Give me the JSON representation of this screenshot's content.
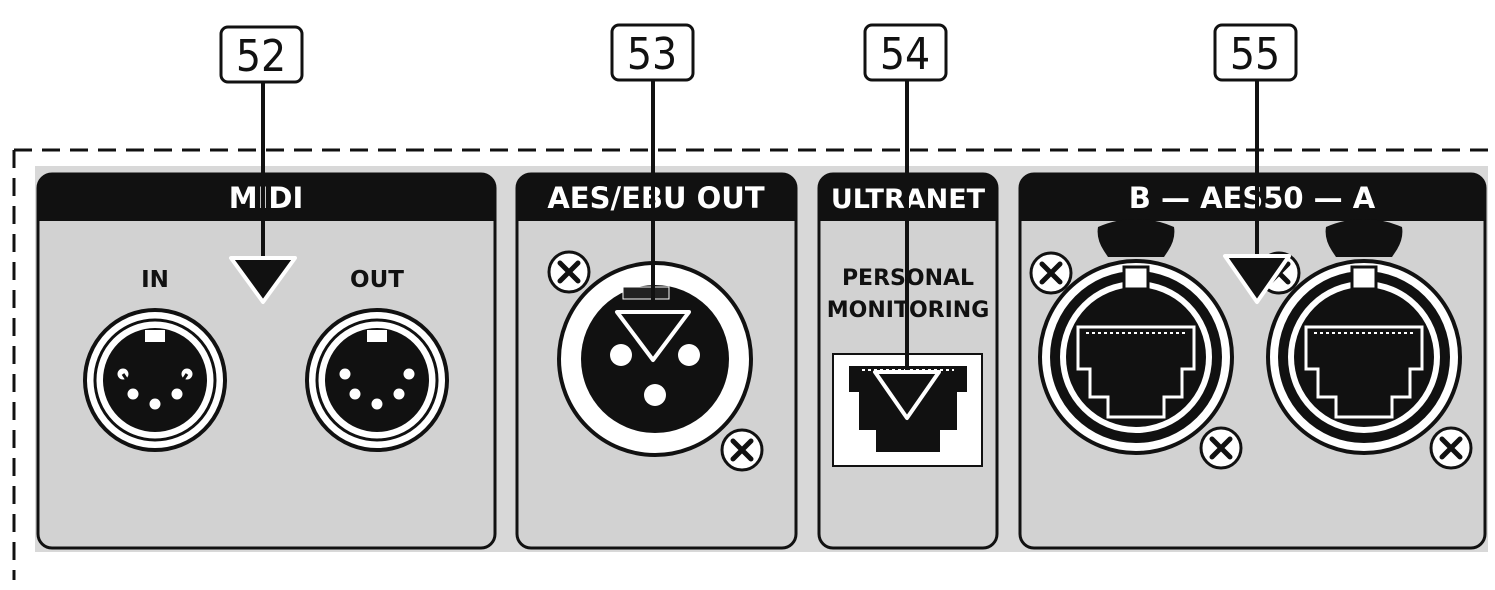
{
  "callouts": [
    {
      "number": "52"
    },
    {
      "number": "53"
    },
    {
      "number": "54"
    },
    {
      "number": "55"
    }
  ],
  "panels": {
    "midi": {
      "title": "MIDI",
      "in_label": "IN",
      "out_label": "OUT"
    },
    "aes_ebu": {
      "title": "AES/EBU OUT"
    },
    "ultranet": {
      "title": "ULTRANET",
      "sub_line1": "PERSONAL",
      "sub_line2": "MONITORING"
    },
    "aes50": {
      "title": "B — AES50 — A"
    }
  },
  "colors": {
    "panel_fill": "#d2d2d2",
    "outer_fill": "#d8d8d8",
    "header_fill": "#111111",
    "line": "#111111"
  }
}
